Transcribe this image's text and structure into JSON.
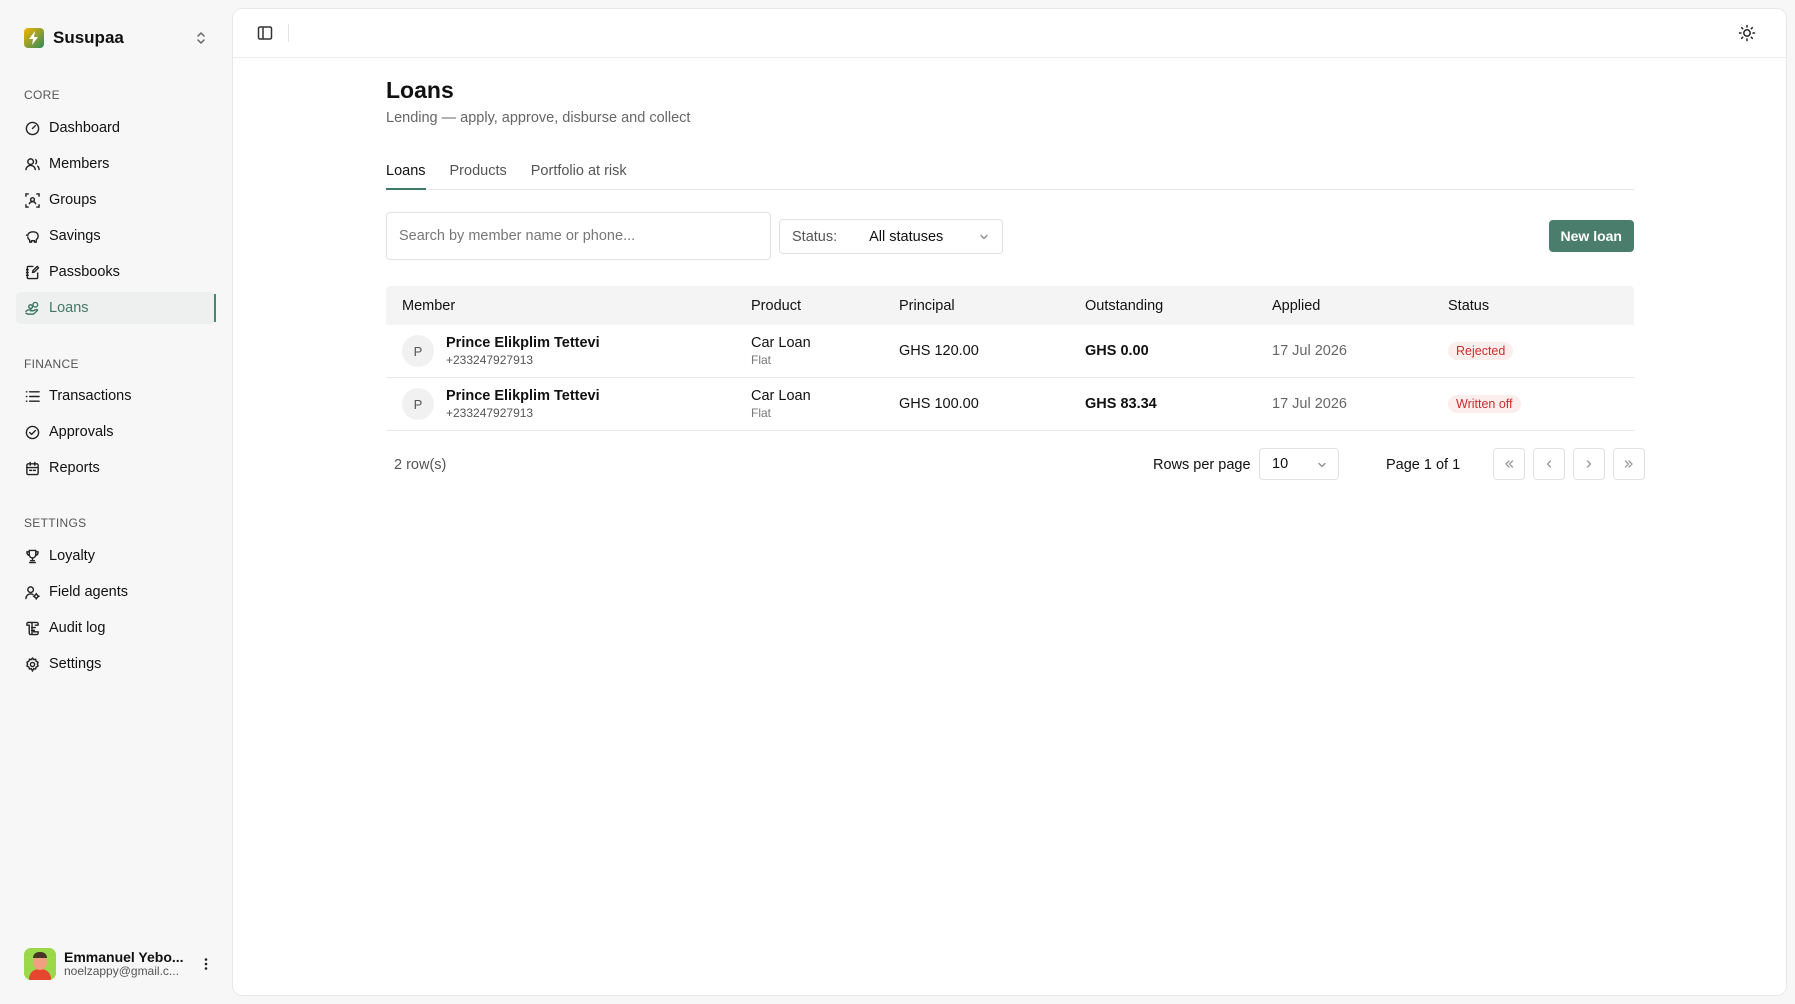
{
  "brand": {
    "name": "Susupaa",
    "logo_icon": "bolt-icon"
  },
  "sidebar": {
    "sections": [
      {
        "label": "CORE"
      },
      {
        "label": "FINANCE"
      },
      {
        "label": "SETTINGS"
      }
    ],
    "items": [
      {
        "label": "Dashboard",
        "icon": "gauge-icon"
      },
      {
        "label": "Members",
        "icon": "users-icon"
      },
      {
        "label": "Groups",
        "icon": "group-scan-icon"
      },
      {
        "label": "Savings",
        "icon": "piggy-bank-icon"
      },
      {
        "label": "Passbooks",
        "icon": "notebook-pen-icon"
      },
      {
        "label": "Loans",
        "icon": "hand-coins-icon",
        "active": true
      },
      {
        "label": "Transactions",
        "icon": "list-icon"
      },
      {
        "label": "Approvals",
        "icon": "check-circle-icon"
      },
      {
        "label": "Reports",
        "icon": "calendar-icon"
      },
      {
        "label": "Loyalty",
        "icon": "trophy-icon"
      },
      {
        "label": "Field agents",
        "icon": "user-cog-icon"
      },
      {
        "label": "Audit log",
        "icon": "scroll-icon"
      },
      {
        "label": "Settings",
        "icon": "gear-icon"
      }
    ],
    "user": {
      "name": "Emmanuel Yebo...",
      "email": "noelzappy@gmail.c..."
    }
  },
  "page": {
    "title": "Loans",
    "subtitle": "Lending — apply, approve, disburse and collect",
    "tabs": [
      {
        "label": "Loans",
        "active": true
      },
      {
        "label": "Products"
      },
      {
        "label": "Portfolio at risk"
      }
    ]
  },
  "toolbar": {
    "search_placeholder": "Search by member name or phone...",
    "status_label": "Status:",
    "status_value": "All statuses",
    "new_button": "New loan"
  },
  "table": {
    "headers": [
      "Member",
      "Product",
      "Principal",
      "Outstanding",
      "Applied",
      "Status"
    ],
    "rows": [
      {
        "initial": "P",
        "member": "Prince Elikplim Tettevi",
        "phone": "+233247927913",
        "product": "Car Loan",
        "product_type": "Flat",
        "principal": "GHS 120.00",
        "outstanding": "GHS 0.00",
        "applied": "17 Jul 2026",
        "status": "Rejected"
      },
      {
        "initial": "P",
        "member": "Prince Elikplim Tettevi",
        "phone": "+233247927913",
        "product": "Car Loan",
        "product_type": "Flat",
        "principal": "GHS 100.00",
        "outstanding": "GHS 83.34",
        "applied": "17 Jul 2026",
        "status": "Written off"
      }
    ]
  },
  "pagination": {
    "row_count": "2 row(s)",
    "rows_per_page_label": "Rows per page",
    "rows_per_page": "10",
    "page_info": "Page 1 of 1"
  },
  "colors": {
    "accent": "#4b7d6c",
    "status_red": "#d12b2b",
    "status_bg": "#fdeeee"
  }
}
